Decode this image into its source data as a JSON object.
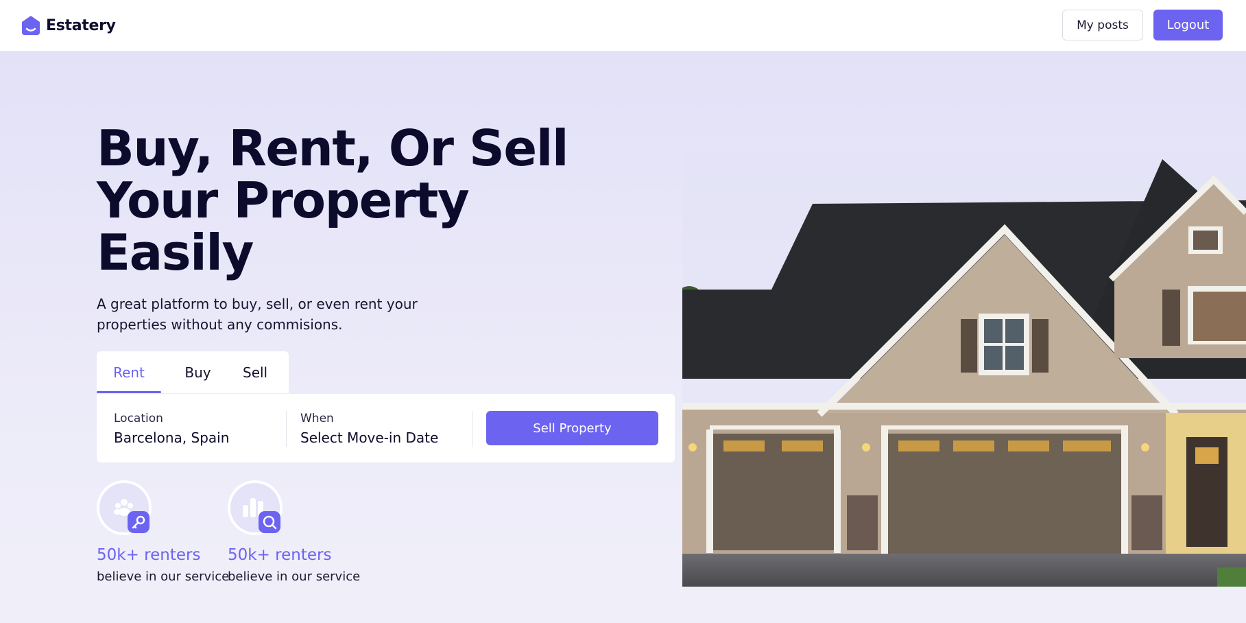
{
  "header": {
    "brand": "Estatery",
    "my_posts_label": "My posts",
    "logout_label": "Logout"
  },
  "hero": {
    "headline": "Buy, Rent, Or Sell Your Property Easily",
    "subline": "A great platform to buy, sell, or even rent your properties without any commisions.",
    "tabs": [
      {
        "label": "Rent",
        "active": true
      },
      {
        "label": "Buy",
        "active": false
      },
      {
        "label": "Sell",
        "active": false
      }
    ],
    "search": {
      "location_label": "Location",
      "location_value": "Barcelona, Spain",
      "when_label": "When",
      "when_value": "Select Move-in Date",
      "action_label": "Sell Property"
    },
    "stats": [
      {
        "value": "50k+ renters",
        "label": "believe in our service",
        "icon": "key-icon"
      },
      {
        "value": "50k+ renters",
        "label": "believe in our service",
        "icon": "search-icon"
      }
    ]
  },
  "colors": {
    "accent": "#6c63f0",
    "hero_background": "#e4e3f7",
    "text_dark": "#0c0b2c"
  }
}
